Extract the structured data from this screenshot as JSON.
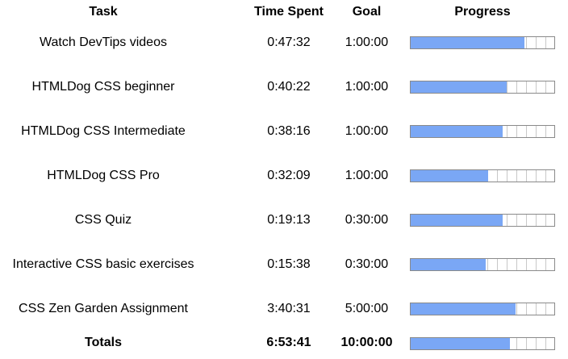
{
  "headers": {
    "task": "Task",
    "time_spent": "Time Spent",
    "goal": "Goal",
    "progress": "Progress"
  },
  "rows": [
    {
      "task": "Watch DevTips videos",
      "time_spent": "0:47:32",
      "goal": "1:00:00",
      "progress": 0.79
    },
    {
      "task": "HTMLDog CSS beginner",
      "time_spent": "0:40:22",
      "goal": "1:00:00",
      "progress": 0.67
    },
    {
      "task": "HTMLDog CSS Intermediate",
      "time_spent": "0:38:16",
      "goal": "1:00:00",
      "progress": 0.64
    },
    {
      "task": "HTMLDog CSS Pro",
      "time_spent": "0:32:09",
      "goal": "1:00:00",
      "progress": 0.54
    },
    {
      "task": "CSS Quiz",
      "time_spent": "0:19:13",
      "goal": "0:30:00",
      "progress": 0.64
    },
    {
      "task": "Interactive CSS basic exercises",
      "time_spent": "0:15:38",
      "goal": "0:30:00",
      "progress": 0.52
    },
    {
      "task": "CSS Zen Garden Assignment",
      "time_spent": "3:40:31",
      "goal": "5:00:00",
      "progress": 0.73
    }
  ],
  "totals": {
    "label": "Totals",
    "time_spent": "6:53:41",
    "goal": "10:00:00",
    "progress": 0.69
  },
  "colors": {
    "progress_fill": "#7aa7f5",
    "progress_border": "#8a8a8a",
    "progress_segment": "#c8c8c8"
  }
}
